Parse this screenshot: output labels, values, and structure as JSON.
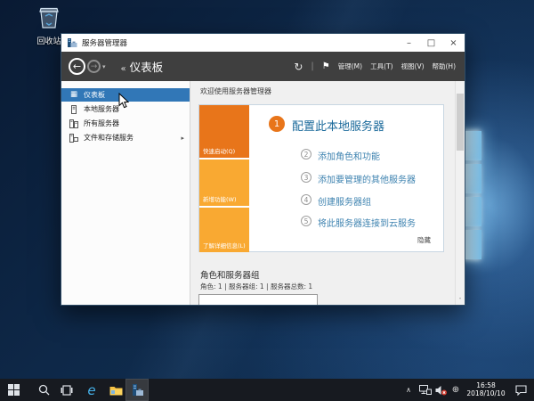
{
  "desktop": {
    "recycle_bin_label": "回收站",
    "taskbar": {
      "clock_time": "16:58",
      "clock_date": "2018/10/10",
      "ie_glyph": "e"
    }
  },
  "window": {
    "title": "服务器管理器",
    "controls": {
      "minimize": "–",
      "maximize": "□",
      "close": "×"
    },
    "nav": {
      "collapse": "«",
      "breadcrumb": "仪表板"
    },
    "menu": {
      "manage": "管理(M)",
      "tools": "工具(T)",
      "view": "视图(V)",
      "help": "帮助(H)"
    },
    "sidebar": [
      {
        "label": "仪表板"
      },
      {
        "label": "本地服务器"
      },
      {
        "label": "所有服务器"
      },
      {
        "label": "文件和存储服务"
      }
    ],
    "main": {
      "welcome_header": "欢迎使用服务器管理器",
      "quick_links": [
        {
          "label": "快速启动(Q)"
        },
        {
          "label": "新增功能(W)"
        },
        {
          "label": "了解详细信息(L)"
        }
      ],
      "steps": [
        {
          "num": "1",
          "label": "配置此本地服务器"
        },
        {
          "num": "2",
          "label": "添加角色和功能"
        },
        {
          "num": "3",
          "label": "添加要管理的其他服务器"
        },
        {
          "num": "4",
          "label": "创建服务器组"
        },
        {
          "num": "5",
          "label": "将此服务器连接到云服务"
        }
      ],
      "hide_link": "隐藏",
      "roles_title": "角色和服务器组",
      "roles_stats": "角色: 1 | 服务器组: 1 | 服务器总数: 1"
    }
  },
  "icons": {
    "back": "←",
    "forward": "→",
    "caret": "▾",
    "refresh": "↻",
    "separator": "|",
    "flag": "⚑",
    "dashboard": "▦",
    "submenu": "▸",
    "scroll_down": "˅",
    "tray_chevron": "∧",
    "input_method": "⊕"
  },
  "colors": {
    "accent_orange": "#e8751a",
    "light_orange": "#f9a932",
    "selected_blue": "#3177b7",
    "link_blue": "#3e83b0",
    "heading_blue": "#1b6a9b"
  }
}
